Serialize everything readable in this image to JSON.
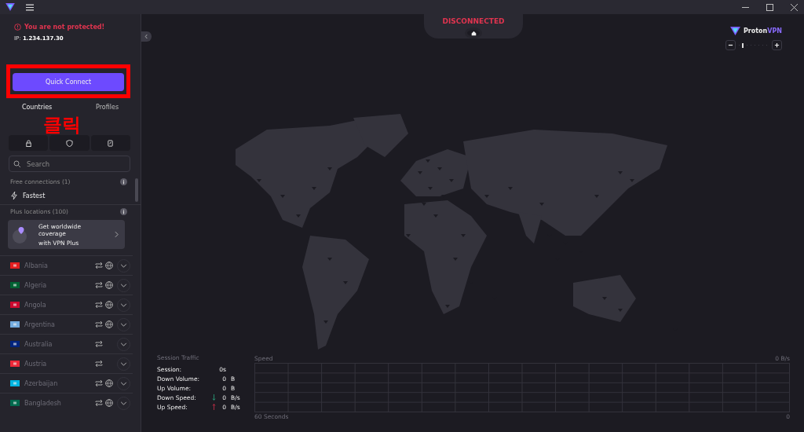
{
  "status": {
    "warning": "You are not protected!",
    "ip_label": "IP:",
    "ip_value": "1.234.137.30"
  },
  "quick_connect": "Quick Connect",
  "annotation": {
    "text": "클릭",
    "color": "#ff0000"
  },
  "tabs": [
    {
      "label": "Countries",
      "selected": true
    },
    {
      "label": "Profiles",
      "selected": false
    }
  ],
  "filters": [
    {
      "kind": "lock",
      "selected": false
    },
    {
      "kind": "shield",
      "selected": false
    },
    {
      "kind": "card",
      "selected": false
    }
  ],
  "search": {
    "placeholder": "Search"
  },
  "free_section": {
    "title": "Free connections (1)",
    "items": [
      {
        "label": "Fastest"
      }
    ]
  },
  "plus_section": {
    "title": "Plus locations (100)"
  },
  "upsell": {
    "lines": [
      "Get worldwide coverage",
      "with VPN Plus"
    ]
  },
  "countries": [
    {
      "name": "Albania",
      "color": "#e41e20",
      "p2p": true,
      "tor": true
    },
    {
      "name": "Algeria",
      "color": "#006233",
      "p2p": true,
      "tor": true
    },
    {
      "name": "Angola",
      "color": "#cc092f",
      "p2p": true,
      "tor": true
    },
    {
      "name": "Argentina",
      "color": "#74acdf",
      "p2p": true,
      "tor": true
    },
    {
      "name": "Australia",
      "color": "#00247d",
      "p2p": true,
      "tor": false
    },
    {
      "name": "Austria",
      "color": "#ed2939",
      "p2p": true,
      "tor": false
    },
    {
      "name": "Azerbaijan",
      "color": "#00b5e2",
      "p2p": true,
      "tor": true
    },
    {
      "name": "Bangladesh",
      "color": "#006a4e",
      "p2p": true,
      "tor": true
    }
  ],
  "connection": {
    "state": "DISCONNECTED",
    "connected": false
  },
  "brand": {
    "name": "Proton",
    "accent": "VPN"
  },
  "zoom": {
    "level": 0.1
  },
  "traffic": {
    "title": "Session Traffic",
    "rows": [
      {
        "label": "Session:",
        "kind": "plain",
        "value": "0s",
        "unit": ""
      },
      {
        "label": "Down Volume:",
        "kind": "plain",
        "value": "0",
        "unit": "B"
      },
      {
        "label": "Up Volume:",
        "kind": "plain",
        "value": "0",
        "unit": "B"
      },
      {
        "label": "Down Speed:",
        "kind": "down",
        "value": "0",
        "unit": "B/s"
      },
      {
        "label": "Up Speed:",
        "kind": "up",
        "value": "0",
        "unit": "B/s"
      }
    ]
  },
  "speed_graph": {
    "title": "Speed",
    "max_label": "0 B/s",
    "min_label": "0",
    "time_label": "60 Seconds"
  }
}
